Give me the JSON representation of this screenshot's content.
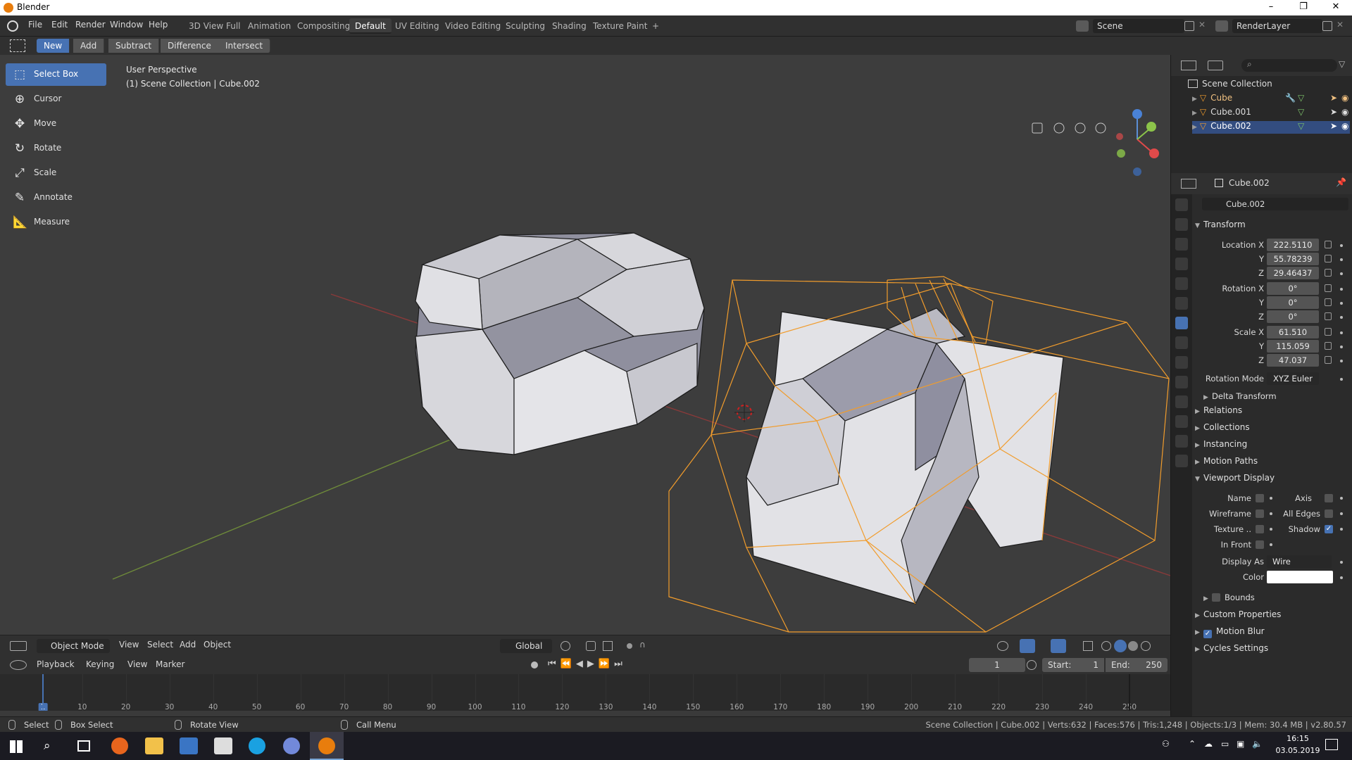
{
  "window": {
    "title": "Blender",
    "minimize": "–",
    "maximize": "❐",
    "close": "✕"
  },
  "menu": [
    "File",
    "Edit",
    "Render",
    "Window",
    "Help"
  ],
  "workspaces": [
    "3D View Full",
    "Animation",
    "Compositing",
    "Default",
    "UV Editing",
    "Video Editing",
    "Sculpting",
    "Shading",
    "Texture Paint"
  ],
  "workspace_add": "+",
  "scene": {
    "label": "Scene",
    "renderlayer": "RenderLayer"
  },
  "bool_buttons": {
    "new": "New",
    "add": "Add",
    "subtract": "Subtract",
    "difference": "Difference",
    "intersect": "Intersect"
  },
  "tools": [
    {
      "label": "Select Box",
      "icon": "select-box-icon",
      "glyph": "⬚"
    },
    {
      "label": "Cursor",
      "icon": "cursor-icon",
      "glyph": "⊕"
    },
    {
      "label": "Move",
      "icon": "move-icon",
      "glyph": "✥"
    },
    {
      "label": "Rotate",
      "icon": "rotate-icon",
      "glyph": "↻"
    },
    {
      "label": "Scale",
      "icon": "scale-icon",
      "glyph": "⤢"
    },
    {
      "label": "Annotate",
      "icon": "annotate-icon",
      "glyph": "✎"
    },
    {
      "label": "Measure",
      "icon": "measure-icon",
      "glyph": "📐"
    }
  ],
  "viewport": {
    "perspective": "User Perspective",
    "collection": "(1) Scene Collection | Cube.002"
  },
  "vheader": {
    "mode": "Object Mode",
    "view": "View",
    "select": "Select",
    "add": "Add",
    "object": "Object",
    "orientation": "Global"
  },
  "timeline": {
    "playback": "Playback",
    "keying": "Keying",
    "view": "View",
    "marker": "Marker",
    "current_frame": "1",
    "start_label": "Start:",
    "start": "1",
    "end_label": "End:",
    "end": "250",
    "ticks": [
      "1",
      "10",
      "20",
      "30",
      "40",
      "50",
      "60",
      "70",
      "80",
      "90",
      "100",
      "110",
      "120",
      "130",
      "140",
      "150",
      "160",
      "170",
      "180",
      "190",
      "200",
      "210",
      "220",
      "230",
      "240",
      "250"
    ]
  },
  "status": {
    "select": "Select",
    "box_select": "Box Select",
    "rotate_view": "Rotate View",
    "call_menu": "Call Menu",
    "info": "Scene Collection | Cube.002 | Verts:632 | Faces:576 | Tris:1,248 | Objects:1/3 | Mem: 30.4 MB | v2.80.57"
  },
  "outliner": {
    "root": "Scene Collection",
    "items": [
      "Cube",
      "Cube.001",
      "Cube.002"
    ]
  },
  "properties": {
    "object_name": "Cube.002",
    "data_name": "Cube.002",
    "transform_label": "Transform",
    "location": {
      "label": "Location X",
      "x": "222.5110",
      "y": "55.78239",
      "z": "29.46437"
    },
    "rotation": {
      "label": "Rotation X",
      "x": "0°",
      "y": "0°",
      "z": "0°"
    },
    "scale": {
      "label": "Scale X",
      "x": "61.510",
      "y": "115.059",
      "z": "47.037"
    },
    "axis_y": "Y",
    "axis_z": "Z",
    "rotation_mode_label": "Rotation Mode",
    "rotation_mode": "XYZ Euler",
    "delta_transform": "Delta Transform",
    "sections": [
      "Relations",
      "Collections",
      "Instancing",
      "Motion Paths"
    ],
    "viewport_display": "Viewport Display",
    "vd": {
      "name": "Name",
      "axis": "Axis",
      "wireframe": "Wireframe",
      "all_edges": "All Edges",
      "texture": "Texture ..",
      "shadow": "Shadow",
      "in_front": "In Front",
      "display_as_label": "Display As",
      "display_as": "Wire",
      "color_label": "Color",
      "bounds": "Bounds"
    },
    "custom_properties": "Custom Properties",
    "motion_blur": "Motion Blur",
    "cycles_settings": "Cycles Settings"
  },
  "taskbar": {
    "time": "16:15",
    "date": "03.05.2019"
  },
  "colors": {
    "accent": "#4772b3",
    "selected": "#f19c2c",
    "header": "#303030",
    "viewport": "#3d3d3d"
  }
}
